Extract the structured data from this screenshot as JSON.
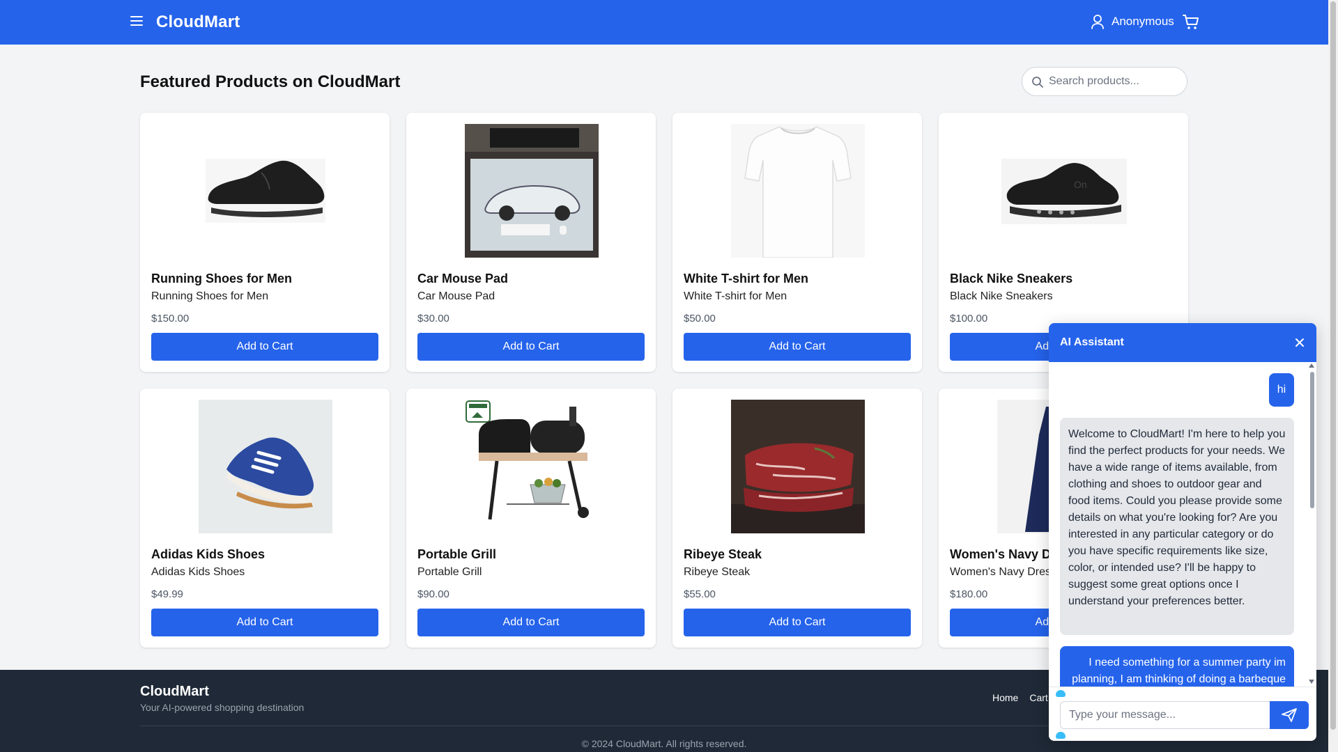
{
  "header": {
    "brand": "CloudMart",
    "user_label": "Anonymous",
    "icons": {
      "menu": "menu-icon",
      "user": "user-icon",
      "cart": "cart-icon"
    }
  },
  "main": {
    "title": "Featured Products on CloudMart",
    "search": {
      "placeholder": "Search products...",
      "value": ""
    }
  },
  "products": [
    {
      "name": "Running Shoes for Men",
      "description": "Running Shoes for Men",
      "price": "$150.00",
      "button": "Add to Cart",
      "image": "black-running-shoe"
    },
    {
      "name": "Car Mouse Pad",
      "description": "Car Mouse Pad",
      "price": "$30.00",
      "button": "Add to Cart",
      "image": "car-mouse-pad"
    },
    {
      "name": "White T-shirt for Men",
      "description": "White T-shirt for Men",
      "price": "$50.00",
      "button": "Add to Cart",
      "image": "white-tshirt"
    },
    {
      "name": "Black Nike Sneakers",
      "description": "Black Nike Sneakers",
      "price": "$100.00",
      "button": "Add to Cart",
      "image": "black-sneaker"
    },
    {
      "name": "Adidas Kids Shoes",
      "description": "Adidas Kids Shoes",
      "price": "$49.99",
      "button": "Add to Cart",
      "image": "blue-kids-shoe"
    },
    {
      "name": "Portable Grill",
      "description": "Portable Grill",
      "price": "$90.00",
      "button": "Add to Cart",
      "image": "barbecue-grill"
    },
    {
      "name": "Ribeye Steak",
      "description": "Ribeye Steak",
      "price": "$55.00",
      "button": "Add to Cart",
      "image": "raw-steak"
    },
    {
      "name": "Women's Navy Dress",
      "description": "Women's Navy Dress",
      "price": "$180.00",
      "button": "Add to Cart",
      "image": "navy-dress"
    }
  ],
  "footer": {
    "brand": "CloudMart",
    "tagline": "Your AI-powered shopping destination",
    "links": [
      "Home",
      "Cart"
    ],
    "copyright": "© 2024 CloudMart. All rights reserved."
  },
  "chat": {
    "title": "AI Assistant",
    "messages": [
      {
        "role": "user",
        "text": "hi"
      },
      {
        "role": "assistant",
        "text": "Welcome to CloudMart! I'm here to help you find the perfect products for your needs. We have a wide range of items available, from clothing and shoes to outdoor gear and food items. Could you please provide some details on what you're looking for? Are you interested in any particular category or do you have specific requirements like size, color, or intended use? I'll be happy to suggest some great options once I understand your preferences better."
      },
      {
        "role": "user",
        "text": "I need something for a summer party im planning, I am thinking of doing a barbeque"
      }
    ],
    "input_placeholder": "Type your message...",
    "input_value": ""
  },
  "colors": {
    "primary": "#2563eb",
    "footer_bg": "#1f2937",
    "page_bg": "#f3f4f6"
  }
}
